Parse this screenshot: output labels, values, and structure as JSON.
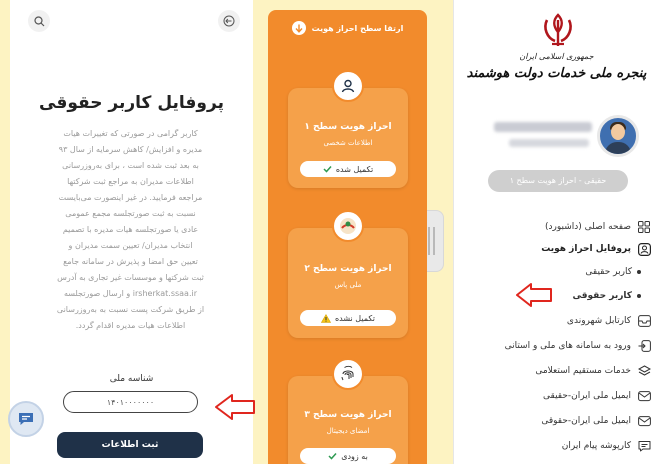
{
  "colors": {
    "accent_orange": "#f28b2c",
    "card_orange": "#f5a14a",
    "navy": "#1f3148",
    "annotation_red": "#e0261e"
  },
  "sidebar": {
    "brand_line1": "جمهوری اسلامی ایران",
    "brand_line2": "پنجره ملی خدمات دولت هوشمند",
    "level_pill": "حقیقی - احراز هویت سطح ۱",
    "nav": [
      {
        "label": "صفحه اصلی (داشبورد)",
        "icon": "grid-icon"
      },
      {
        "label": "پروفایل احراز هویت",
        "icon": "user-id-icon"
      },
      {
        "label": "کارتابل شهروندی",
        "icon": "inbox-icon"
      },
      {
        "label": "ورود به سامانه های ملی و استانی",
        "icon": "login-icon"
      },
      {
        "label": "خدمات مستقیم استعلامی",
        "icon": "layers-icon"
      },
      {
        "label": "ایمیل ملی ایران-حقیقی",
        "icon": "mail-icon"
      },
      {
        "label": "ایمیل ملی ایران-حقوقی",
        "icon": "mail-icon"
      },
      {
        "label": "کارپوشه پیام ایران",
        "icon": "message-icon"
      }
    ],
    "sub_items": [
      {
        "label": "کاربر حقیقی"
      },
      {
        "label": "کاربر حقوقی"
      }
    ]
  },
  "steps": {
    "header": "ارتقا سطح احراز هویت",
    "cards": [
      {
        "title": "احراز هویت سطح ۱",
        "subtitle": "اطلاعات شخصی",
        "status": "تکمیل شده",
        "status_icon": "check-icon"
      },
      {
        "title": "احراز هویت سطح ۲",
        "subtitle": "ملی پاس",
        "status": "تکمیل نشده",
        "status_icon": "warning-icon"
      },
      {
        "title": "احراز هویت سطح ۳",
        "subtitle": "امضای دیجیتال",
        "status": "به زودی",
        "status_icon": "check-icon"
      }
    ]
  },
  "content": {
    "title": "پروفایل کاربر حقوقی",
    "description": [
      "کاربر گرامی در صورتی که تغییرات هیات",
      "مدیره و افزایش/ کاهش سرمایه از سال ۹۳",
      "به بعد ثبت شده است ، برای به‌روزرسانی",
      "اطلاعات مدیران به مراجع ثبت شرکتها",
      "مراجعه فرمایید. در غیر اینصورت می‌بایست",
      "نسبت به ثبت صورتجلسه مجمع عمومی",
      "عادی یا صورتجلسه هیات مدیره با تصمیم",
      "انتخاب مدیران/ تعیین سمت مدیران و",
      "تعیین حق امضا و پذیرش در سامانه جامع",
      "ثبت شرکتها و موسسات غیر تجاری به آدرس",
      "irsherkat.ssaa.ir و ارسال صورتجلسه",
      "از طریق شرکت پست نسبت به به‌روزرسانی",
      "اطلاعات هیات مدیره اقدام گردد."
    ],
    "national_id_label": "شناسه ملی",
    "national_id_value": "۱۴۰۱۰۰۰۰۰۰۰",
    "submit_label": "ثبت اطلاعات"
  }
}
